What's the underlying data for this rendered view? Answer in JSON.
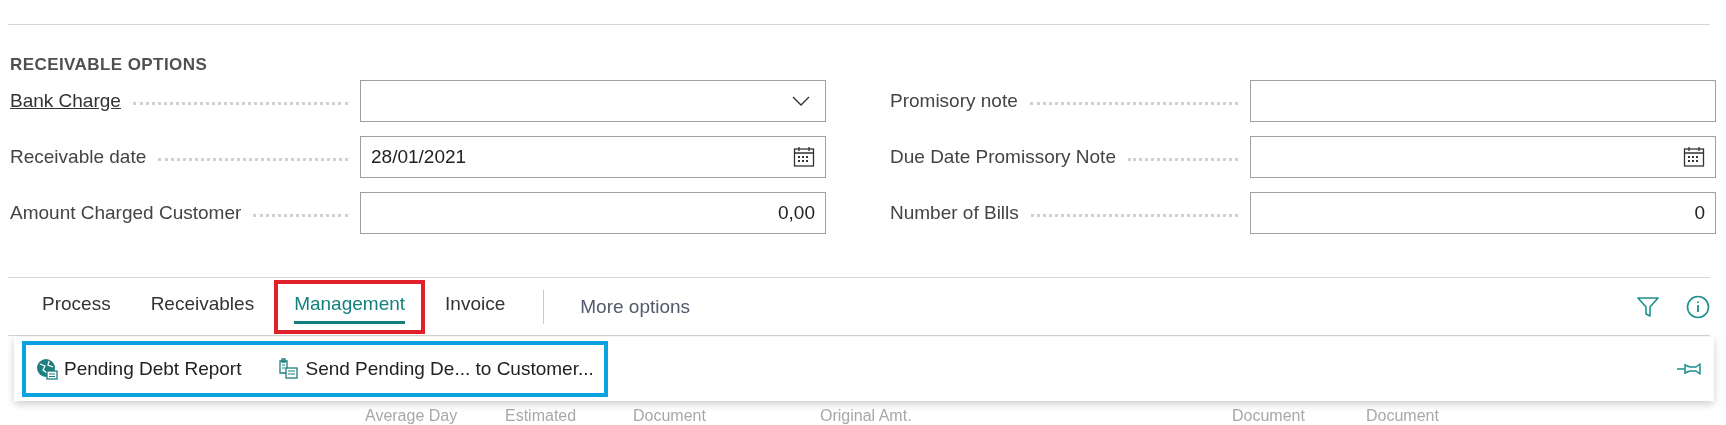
{
  "section": {
    "title": "RECEIVABLE OPTIONS",
    "left_fields": [
      {
        "label": "Bank Charge",
        "kind": "dropdown",
        "link": true
      },
      {
        "label": "Receivable date",
        "kind": "date",
        "link": false,
        "value": "28/01/2021"
      },
      {
        "label": "Amount Charged Customer",
        "kind": "number",
        "link": false,
        "value": "0,00"
      }
    ],
    "right_fields": [
      {
        "label": "Promisory note",
        "kind": "text",
        "link": false
      },
      {
        "label": "Due Date Promissory Note",
        "kind": "date",
        "link": false
      },
      {
        "label": "Number of Bills",
        "kind": "number",
        "link": false,
        "value": "0"
      }
    ]
  },
  "action_bar": {
    "tabs": [
      {
        "label": "Process",
        "selected": false,
        "highlighted": false
      },
      {
        "label": "Receivables",
        "selected": false,
        "highlighted": false
      },
      {
        "label": "Management",
        "selected": true,
        "highlighted": true
      },
      {
        "label": "Invoice",
        "selected": false,
        "highlighted": false
      }
    ],
    "more": "More options"
  },
  "menu": {
    "highlighted": true,
    "items": [
      {
        "label": "Pending Debt Report",
        "kind": "report"
      },
      {
        "label": "Send Pending De... to Customer...",
        "kind": "send"
      }
    ]
  },
  "list_columns": [
    "Average Day",
    "Estimated",
    "Document",
    "Original Amt.",
    "Document",
    "Document"
  ]
}
